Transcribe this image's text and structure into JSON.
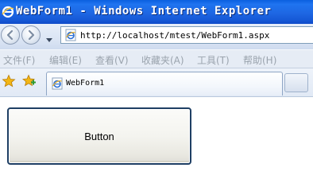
{
  "window": {
    "title": "WebForm1 - Windows Internet Explorer"
  },
  "navigation": {
    "back_icon": "back-arrow-icon",
    "forward_icon": "forward-arrow-icon",
    "history_icon": "chevron-down-icon"
  },
  "address_bar": {
    "page_icon": "ie-page-icon",
    "url": "http://localhost/mtest/WebForm1.aspx"
  },
  "menu": {
    "items": [
      {
        "label": "文件(F)"
      },
      {
        "label": "编辑(E)"
      },
      {
        "label": "查看(V)"
      },
      {
        "label": "收藏夹(A)"
      },
      {
        "label": "工具(T)"
      },
      {
        "label": "帮助(H)"
      }
    ]
  },
  "favorites_bar": {
    "favorites_icon": "star-icon",
    "add_favorite_icon": "add-favorite-icon"
  },
  "tabs": [
    {
      "label": "WebForm1",
      "icon": "ie-page-icon"
    }
  ],
  "page": {
    "button_label": "Button"
  },
  "colors": {
    "titlebar": "#1f6fe8",
    "address_border": "#7f9db9",
    "menu_text_disabled": "#9aa3ad",
    "button_border": "#1f3f64"
  }
}
